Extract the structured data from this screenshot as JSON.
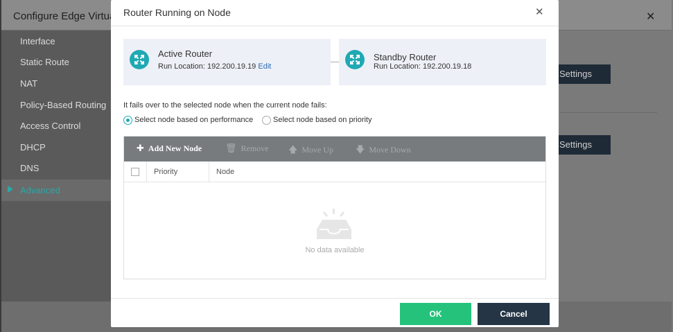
{
  "background": {
    "title": "Configure Edge Virtua",
    "sidebar_items": [
      "Interface",
      "Static Route",
      "NAT",
      "Policy-Based Routing",
      "Access Control",
      "DHCP",
      "DNS"
    ],
    "sidebar_active": "Advanced",
    "settings_label": "Settings"
  },
  "modal": {
    "title": "Router Running on Node",
    "active_router": {
      "name": "Active Router",
      "location_label": "Run Location:",
      "location": "192.200.19.19",
      "edit": "Edit"
    },
    "standby_router": {
      "name": "Standby Router",
      "location_label": "Run Location:",
      "location": "192.200.19.18"
    },
    "failover_description": "It fails over to the selected node when the current node fails:",
    "radio_options": [
      {
        "label": "Select node based on performance",
        "checked": true
      },
      {
        "label": "Select node based on priority",
        "checked": false
      }
    ],
    "toolbar": {
      "add": "Add New Node",
      "remove": "Remove",
      "move_up": "Move Up",
      "move_down": "Move Down"
    },
    "table": {
      "columns": [
        "Priority",
        "Node"
      ],
      "rows": [],
      "empty_text": "No data available"
    },
    "footer": {
      "ok": "OK",
      "cancel": "Cancel"
    }
  },
  "colors": {
    "accent": "#1fa9b4",
    "ok_button": "#25c27c",
    "cancel_button": "#253545",
    "toolbar": "#777b7e"
  }
}
